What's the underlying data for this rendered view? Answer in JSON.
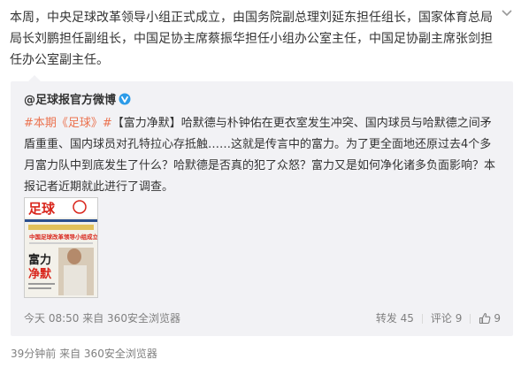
{
  "post": {
    "text": "本周，中央足球改革领导小组正式成立，由国务院副总理刘延东担任组长，国家体育总局局长刘鹏担任副组长，中国足协主席蔡振华担任小组办公室主任，中国足协副主席张剑担任办公室副主任。",
    "footer_time": "39分钟前",
    "footer_from": "来自 360安全浏览器"
  },
  "repost": {
    "author": "@足球报官方微博",
    "topic": "#本期《足球》#",
    "text": "【富力净默】哈默德与朴钟佑在更衣室发生冲突、国内球员与哈默德之间矛盾重重、国内球员对孔特拉心存抵触……这就是传言中的富力。为了更全面地还原过去4个多月富力队中到底发生了什么？哈默德是否真的犯了众怒？富力又是如何净化诸多负面影响？本报记者近期就此进行了调查。",
    "time": "今天 08:50",
    "from": "来自 360安全浏览器",
    "repost_label": "转发 45",
    "comment_label": "评论 9",
    "like_count": "9"
  },
  "thumbnail": {
    "masthead": "足球",
    "headline": "中国足球改革领导小组成立",
    "cover_title_1": "富力",
    "cover_title_2": "净默"
  },
  "colors": {
    "accent": "#eb7350",
    "link": "#eb7350",
    "verified": "#2c9be8",
    "masthead_red": "#d9261c"
  },
  "icons": {
    "dropdown": "chevron-down-icon",
    "verified": "verified-v-icon",
    "like": "thumbs-up-icon"
  }
}
